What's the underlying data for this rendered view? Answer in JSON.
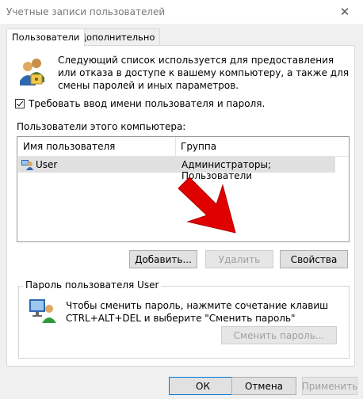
{
  "window": {
    "title": "Учетные записи пользователей",
    "close_glyph": "✕"
  },
  "tabs": [
    {
      "label": "Пользователи"
    },
    {
      "label": "Дополнительно"
    }
  ],
  "users_tab": {
    "description": "Следующий список используется для предоставления или отказа в доступе к вашему компьютеру, а также для смены паролей и иных параметров.",
    "require_login_label": "Требовать ввод имени пользователя и пароля.",
    "require_login_checked": true,
    "users_list_label": "Пользователи этого компьютера:",
    "columns": {
      "name": "Имя пользователя",
      "group": "Группа"
    },
    "rows": [
      {
        "name": "User",
        "group": "Администраторы; Пользователи"
      }
    ],
    "buttons": {
      "add": "Добавить...",
      "remove": "Удалить",
      "properties": "Свойства"
    },
    "password_group": {
      "title": "Пароль пользователя User",
      "message_line1": "Чтобы сменить пароль, нажмите сочетание клавиш",
      "message_line2": "CTRL+ALT+DEL и выберите \"Сменить пароль\"",
      "change_button": "Сменить пароль..."
    }
  },
  "footer": {
    "ok": "ОК",
    "cancel": "Отмена",
    "apply": "Применить"
  },
  "colors": {
    "accent": "#0078d7",
    "arrow": "#e00000"
  }
}
